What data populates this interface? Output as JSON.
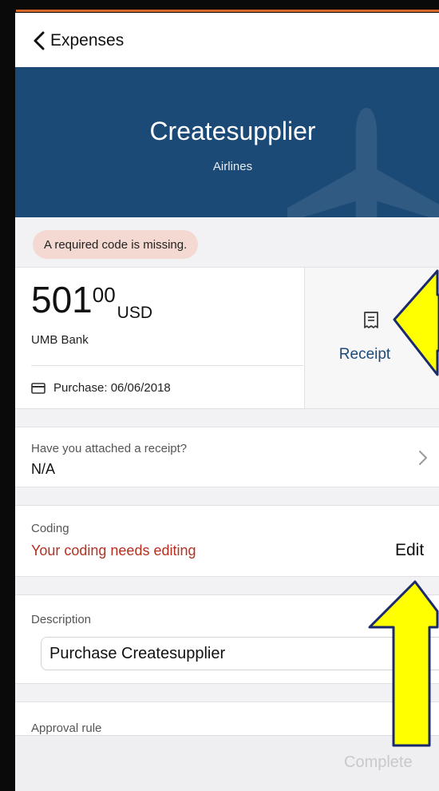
{
  "nav": {
    "back_label": "Expenses"
  },
  "hero": {
    "title": "Createsupplier",
    "subtitle": "Airlines",
    "background_color": "#1c4a77",
    "background_icon": "airplane-icon"
  },
  "warning": {
    "text": "A required code is missing.",
    "color": "#f3d9d1"
  },
  "summary": {
    "amount_whole": "501",
    "amount_cents": "00",
    "currency": "USD",
    "bank": "UMB Bank",
    "purchase_label": "Purchase: 06/06/2018",
    "purchase_icon": "card-icon",
    "receipt_label": "Receipt",
    "receipt_icon": "receipt-icon"
  },
  "attach": {
    "label": "Have you attached a receipt?",
    "value": "N/A"
  },
  "coding": {
    "label": "Coding",
    "error": "Your coding needs editing",
    "edit_label": "Edit",
    "error_color": "#b5301f"
  },
  "description": {
    "label": "Description",
    "value": "Purchase Createsupplier"
  },
  "approval": {
    "label": "Approval rule"
  },
  "footer": {
    "complete_label": "Complete"
  },
  "annotations": {
    "arrow_color": "#ffff00",
    "arrow_stroke": "#1a2a6c"
  }
}
